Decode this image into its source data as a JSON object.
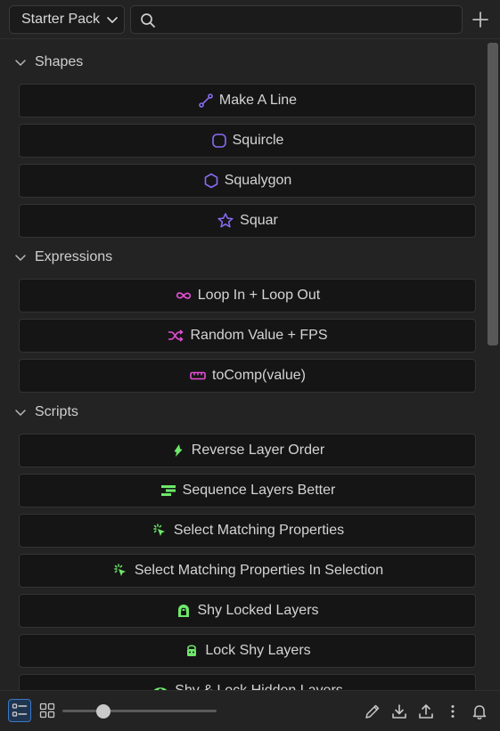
{
  "header": {
    "pack_selector": "Starter Pack",
    "search_placeholder": "",
    "search_value": ""
  },
  "sections": [
    {
      "title": "Shapes",
      "items": [
        {
          "label": "Make A Line",
          "icon": "line-icon",
          "color": "#8a6cf5"
        },
        {
          "label": "Squircle",
          "icon": "squircle-icon",
          "color": "#8a6cf5"
        },
        {
          "label": "Squalygon",
          "icon": "hexagon-icon",
          "color": "#8a6cf5"
        },
        {
          "label": "Squar",
          "icon": "star-icon",
          "color": "#8a6cf5"
        }
      ]
    },
    {
      "title": "Expressions",
      "items": [
        {
          "label": "Loop In + Loop Out",
          "icon": "infinity-icon",
          "color": "#e64fd6"
        },
        {
          "label": "Random Value + FPS",
          "icon": "shuffle-icon",
          "color": "#e64fd6"
        },
        {
          "label": "toComp(value)",
          "icon": "ruler-icon",
          "color": "#e64fd6"
        }
      ]
    },
    {
      "title": "Scripts",
      "items": [
        {
          "label": "Reverse Layer Order",
          "icon": "reverse-icon",
          "color": "#6ee86a"
        },
        {
          "label": "Sequence Layers Better",
          "icon": "sequence-icon",
          "color": "#6ee86a"
        },
        {
          "label": "Select Matching Properties",
          "icon": "select-cursor-icon",
          "color": "#6ee86a"
        },
        {
          "label": "Select Matching Properties In Selection",
          "icon": "select-cursor-icon",
          "color": "#6ee86a"
        },
        {
          "label": "Shy Locked Layers",
          "icon": "shy-lock-icon",
          "color": "#6ee86a"
        },
        {
          "label": "Lock Shy Layers",
          "icon": "lock-shy-icon",
          "color": "#6ee86a"
        },
        {
          "label": "Shy & Lock Hidden Layers",
          "icon": "eye-lock-icon",
          "color": "#6ee86a"
        }
      ]
    }
  ],
  "footer": {
    "view_mode": "list",
    "zoom_slider_value": 0.27,
    "icons": [
      "list-view-icon",
      "grid-view-icon",
      "pencil-icon",
      "download-icon",
      "upload-icon",
      "more-vertical-icon",
      "bell-icon"
    ]
  }
}
